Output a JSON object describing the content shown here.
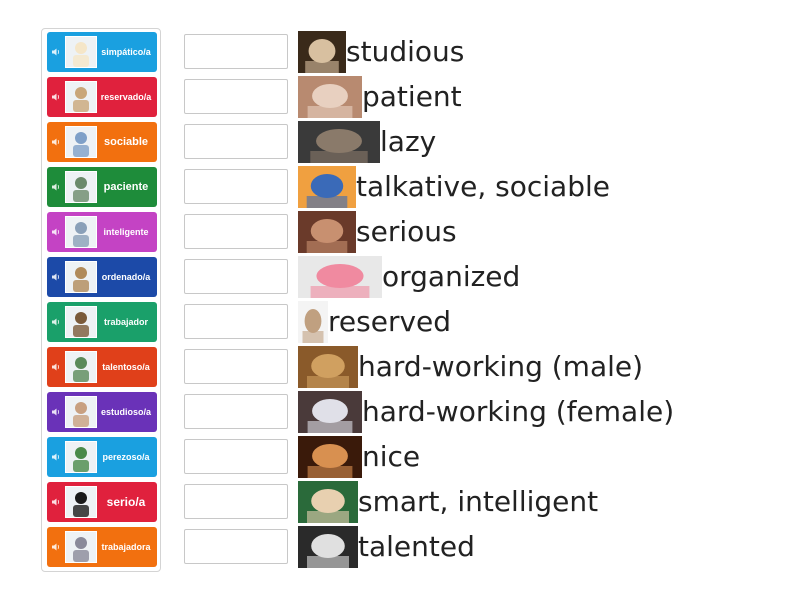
{
  "tiles": [
    {
      "label": "simpático/a",
      "color": "#1aa0e0",
      "size": "small"
    },
    {
      "label": "reservado/a",
      "color": "#e0213d",
      "size": "small"
    },
    {
      "label": "sociable",
      "color": "#f2700f",
      "size": "med"
    },
    {
      "label": "paciente",
      "color": "#1e8c3a",
      "size": "med"
    },
    {
      "label": "inteligente",
      "color": "#c443c4",
      "size": "small"
    },
    {
      "label": "ordenado/a",
      "color": "#1c4aa8",
      "size": "small"
    },
    {
      "label": "trabajador",
      "color": "#1aa06a",
      "size": "small"
    },
    {
      "label": "talentoso/a",
      "color": "#e0401a",
      "size": "small"
    },
    {
      "label": "estudioso/a",
      "color": "#6a32b8",
      "size": "small"
    },
    {
      "label": "perezoso/a",
      "color": "#1aa0e0",
      "size": "small"
    },
    {
      "label": "serio/a",
      "color": "#e0213d",
      "size": "big"
    },
    {
      "label": "trabajadora",
      "color": "#f2700f",
      "size": "small"
    }
  ],
  "definitions": [
    {
      "text": "studious",
      "image": "baby-reading-image"
    },
    {
      "text": "patient",
      "image": "holding-hands-image"
    },
    {
      "text": "lazy",
      "image": "man-sleeping-image"
    },
    {
      "text": "talkative, sociable",
      "image": "group-talking-image"
    },
    {
      "text": "serious",
      "image": "serious-man-image"
    },
    {
      "text": "organized",
      "image": "tidy-room-image"
    },
    {
      "text": "reserved",
      "image": "shy-person-image"
    },
    {
      "text": "hard-working (male)",
      "image": "stacked-books-image"
    },
    {
      "text": "hard-working (female)",
      "image": "woman-working-image"
    },
    {
      "text": "nice",
      "image": "people-hugging-image"
    },
    {
      "text": "smart, intelligent",
      "image": "graduate-image"
    },
    {
      "text": "talented",
      "image": "piano-image"
    }
  ]
}
